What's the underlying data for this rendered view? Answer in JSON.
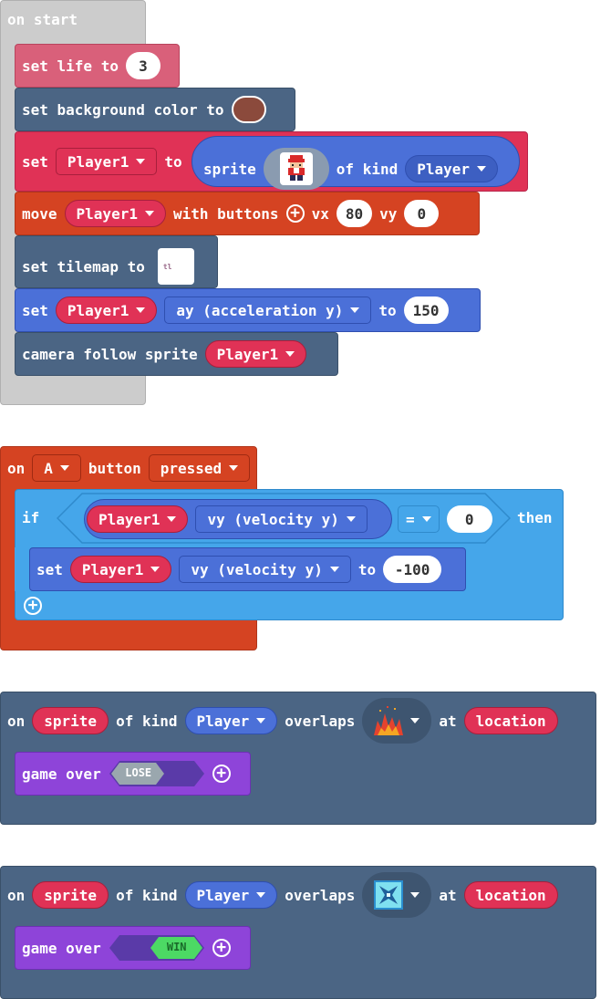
{
  "colors": {
    "hat_gray": "#cccccc",
    "info_pink": "#d9607a",
    "scene_slate": "#4b6584",
    "sprites_red": "#e03256",
    "controller_orange": "#d54322",
    "logic_blue": "#45a6ea",
    "kind_blue": "#4b70d8",
    "game_purple": "#8e44d9",
    "bg_color_swatch": "#8b4a3c"
  },
  "on_start": {
    "header": "on start",
    "set_life": {
      "label": "set life to",
      "value": "3"
    },
    "bg_color": {
      "label": "set background color to"
    },
    "set_player": {
      "set": "set",
      "var": "Player1",
      "to": "to",
      "sprite": "sprite",
      "of_kind": "of kind",
      "kind": "Player",
      "image_icon": "player-sprite-icon"
    },
    "move": {
      "label": "move",
      "var": "Player1",
      "with_buttons": "with buttons",
      "vx_label": "vx",
      "vx": "80",
      "vy_label": "vy",
      "vy": "0"
    },
    "tilemap": {
      "label": "set tilemap to",
      "preview_text": "tl"
    },
    "set_ay": {
      "set": "set",
      "var": "Player1",
      "prop": "ay (acceleration y)",
      "to": "to",
      "value": "150"
    },
    "camera": {
      "label": "camera follow sprite",
      "var": "Player1"
    }
  },
  "on_button": {
    "on": "on",
    "button": "A",
    "button_label": "button",
    "event": "pressed",
    "if_label": "if",
    "then_label": "then",
    "cond": {
      "var": "Player1",
      "prop": "vy (velocity y)",
      "op": "=",
      "value": "0"
    },
    "set_vy": {
      "set": "set",
      "var": "Player1",
      "prop": "vy (velocity y)",
      "to": "to",
      "value": "-100"
    }
  },
  "overlap_lose": {
    "on": "on",
    "sprite": "sprite",
    "of_kind": "of kind",
    "kind": "Player",
    "overlaps": "overlaps",
    "tile_icon": "fire-tile-icon",
    "at": "at",
    "location": "location",
    "game_over": "game over",
    "result": "LOSE"
  },
  "overlap_win": {
    "on": "on",
    "sprite": "sprite",
    "of_kind": "of kind",
    "kind": "Player",
    "overlaps": "overlaps",
    "tile_icon": "portal-tile-icon",
    "at": "at",
    "location": "location",
    "game_over": "game over",
    "result": "WIN"
  }
}
